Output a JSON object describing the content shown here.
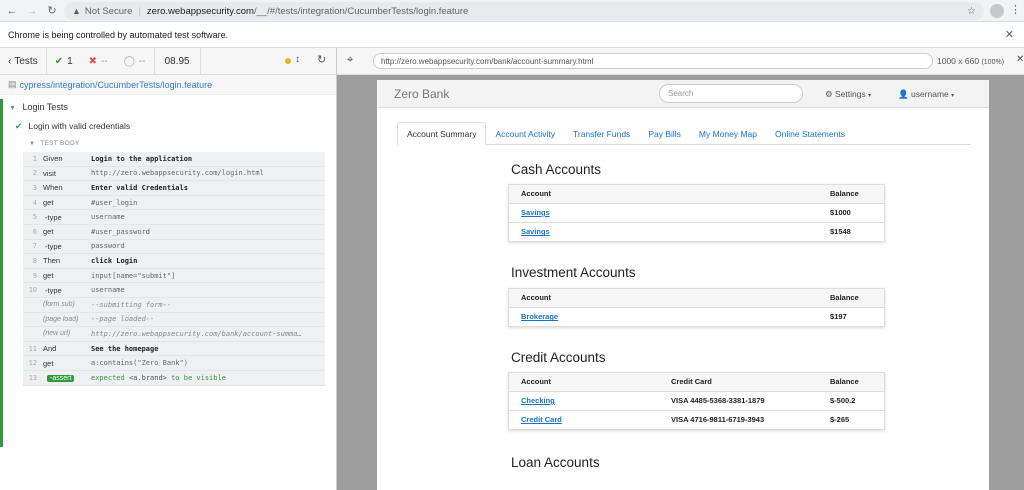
{
  "browser": {
    "security_label": "Not Secure",
    "url_host": "zero.webappsecurity.com",
    "url_path": "/__/#/tests/integration/CucumberTests/login.feature",
    "infobar_text": "Chrome is being controlled by automated test software."
  },
  "reporter": {
    "tests_label": "Tests",
    "passed": "1",
    "failed": "--",
    "pending": "--",
    "duration": "08.95",
    "spec_path": "cypress/integration/CucumberTests/login.feature",
    "suite_title": "Login Tests",
    "test_title": "Login with valid credentials",
    "test_body_label": "TEST BODY",
    "commands": [
      {
        "num": "1",
        "name": "Given",
        "msg": "Login to the application",
        "bold": true
      },
      {
        "num": "2",
        "name": "visit",
        "msg": "http://zero.webappsecurity.com/login.html"
      },
      {
        "num": "3",
        "name": "When",
        "msg": "Enter valid Credentials",
        "bold": true
      },
      {
        "num": "4",
        "name": "get",
        "msg": "#user_login"
      },
      {
        "num": "5",
        "name": "-type",
        "msg": "username"
      },
      {
        "num": "6",
        "name": "get",
        "msg": "#user_password"
      },
      {
        "num": "7",
        "name": "-type",
        "msg": "password"
      },
      {
        "num": "8",
        "name": "Then",
        "msg": "click Login",
        "bold": true
      },
      {
        "num": "9",
        "name": "get",
        "msg": "input[name=\"submit\"]"
      },
      {
        "num": "10",
        "name": "-type",
        "msg": "username"
      },
      {
        "event": true,
        "name": "(form sub)",
        "msg": "--submitting form--"
      },
      {
        "event": true,
        "name": "(page load)",
        "msg": "--page loaded--"
      },
      {
        "event": true,
        "name": "(new url)",
        "msg": "http://zero.webappsecurity.com/bank/account-summary.html"
      },
      {
        "num": "11",
        "name": "And",
        "msg": "See the homepage",
        "bold": true
      },
      {
        "num": "12",
        "name": "get",
        "msg": "a:contains(\"Zero Bank\")"
      },
      {
        "num": "13",
        "name": "-assert",
        "assert": true,
        "msg_a": "expected",
        "msg_b": "<a.brand>",
        "msg_c": "to be",
        "msg_d": "visible"
      }
    ]
  },
  "aut_bar": {
    "url": "http://zero.webappsecurity.com/bank/account-summary.html",
    "viewport": "1000 x 660",
    "zoom": "(100%)"
  },
  "zerobank": {
    "brand": "Zero Bank",
    "search_placeholder": "Search",
    "settings": "Settings",
    "username": "username",
    "tabs": [
      "Account Summary",
      "Account Activity",
      "Transfer Funds",
      "Pay Bills",
      "My Money Map",
      "Online Statements"
    ],
    "cash": {
      "title": "Cash Accounts",
      "headers": [
        "Account",
        "Balance"
      ],
      "rows": [
        [
          "Savings",
          "$1000"
        ],
        [
          "Savings",
          "$1548"
        ]
      ]
    },
    "investment": {
      "title": "Investment Accounts",
      "headers": [
        "Account",
        "Balance"
      ],
      "rows": [
        [
          "Brokerage",
          "$197"
        ]
      ]
    },
    "credit": {
      "title": "Credit Accounts",
      "headers": [
        "Account",
        "Credit Card",
        "Balance"
      ],
      "rows": [
        [
          "Checking",
          "VISA 4485-5368-3381-1879",
          "$-500.2"
        ],
        [
          "Credit Card",
          "VISA 4716-9811-6719-3943",
          "$-265"
        ]
      ]
    },
    "loan": {
      "title": "Loan Accounts"
    }
  }
}
